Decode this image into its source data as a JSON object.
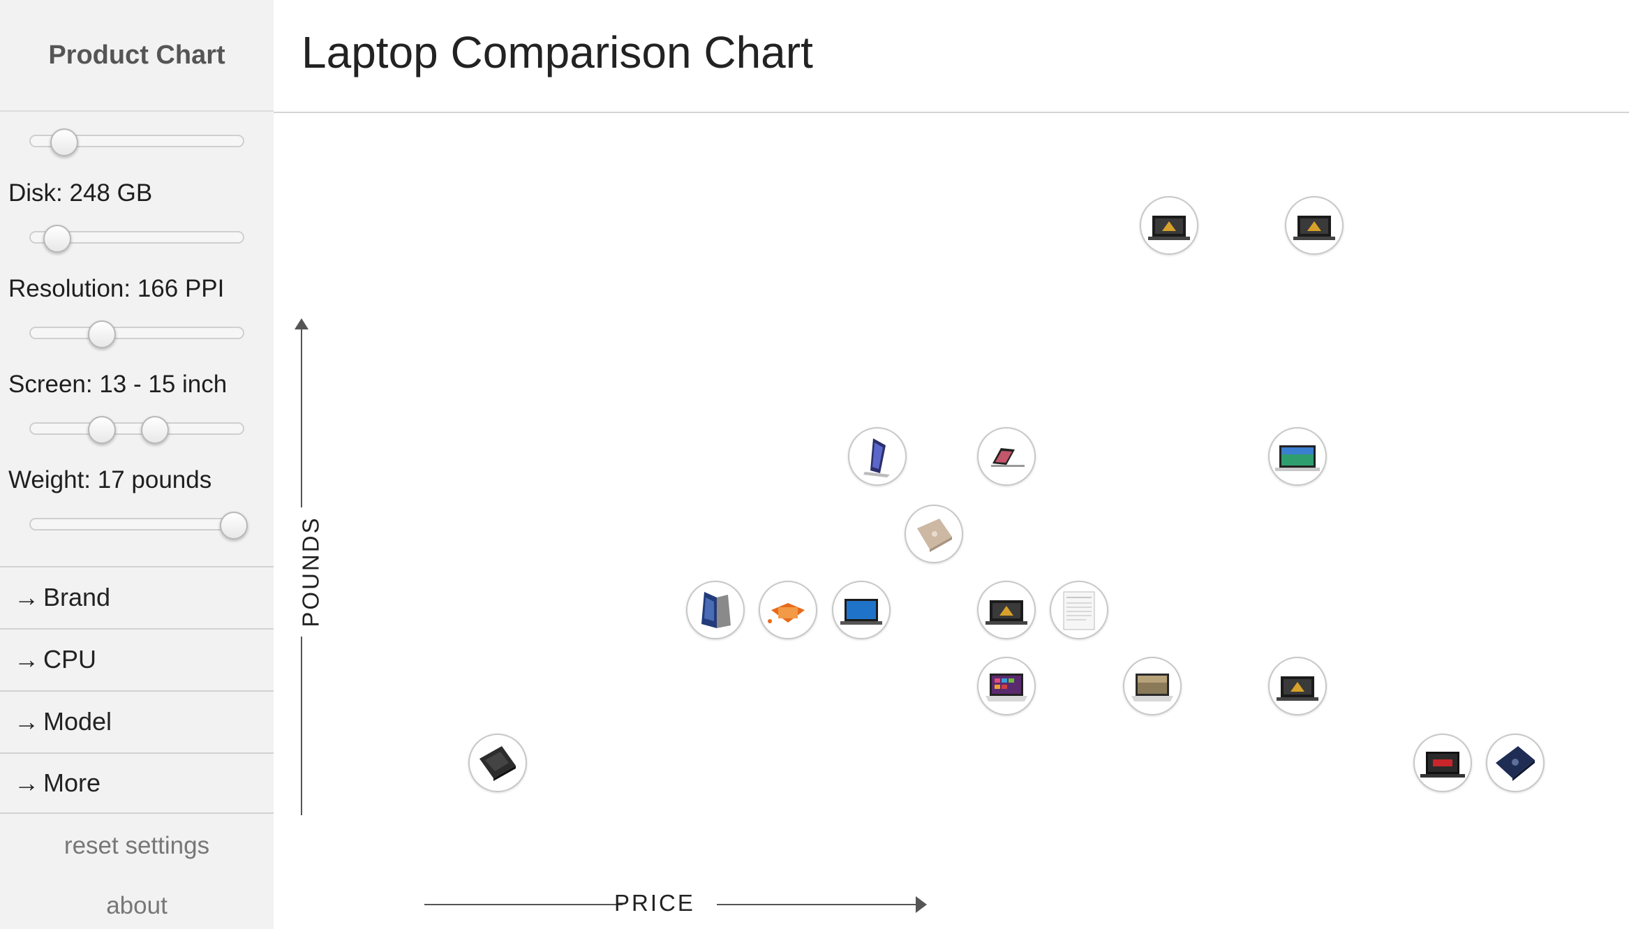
{
  "app": {
    "brand": "Product Chart",
    "title": "Laptop Comparison Chart"
  },
  "filters": {
    "top_slider": {
      "value_fraction": 0.15
    },
    "disk": {
      "label": "Disk: 248 GB",
      "value_fraction": 0.12
    },
    "resolution": {
      "label": "Resolution: 166 PPI",
      "value_fraction": 0.33
    },
    "screen": {
      "label": "Screen: 13 - 15 inch",
      "low_fraction": 0.33,
      "high_fraction": 0.58
    },
    "weight": {
      "label": "Weight: 17 pounds",
      "value_fraction": 0.95
    }
  },
  "menu": [
    "Brand",
    "CPU",
    "Model",
    "More"
  ],
  "menu_arrow": "→",
  "links": {
    "reset": "reset settings",
    "about": "about"
  },
  "chart": {
    "x_axis_label": "PRICE",
    "y_axis_label": "POUNDS",
    "products": [
      {
        "name": "black-gaming-laptop",
        "style": "dark-screen"
      },
      {
        "name": "black-gaming-laptop",
        "style": "dark-screen"
      },
      {
        "name": "convertible-tablet",
        "style": "tablet"
      },
      {
        "name": "macbook-pro",
        "style": "mac"
      },
      {
        "name": "imac-style-laptop",
        "style": "mac-color"
      },
      {
        "name": "silver-zenbook",
        "style": "silver-lid"
      },
      {
        "name": "yoga-convertible",
        "style": "tent"
      },
      {
        "name": "orange-yoga",
        "style": "orange"
      },
      {
        "name": "blue-screen-laptop",
        "style": "blue-screen"
      },
      {
        "name": "thinkpad-laptop",
        "style": "dark-screen"
      },
      {
        "name": "spec-sheet",
        "style": "doc"
      },
      {
        "name": "windows-laptop",
        "style": "win"
      },
      {
        "name": "photo-laptop",
        "style": "photo"
      },
      {
        "name": "black-laptop",
        "style": "dark-screen"
      },
      {
        "name": "dark-zenbook",
        "style": "dark-lid"
      },
      {
        "name": "msi-laptop",
        "style": "msi"
      },
      {
        "name": "navy-zenbook",
        "style": "navy-lid"
      }
    ]
  }
}
